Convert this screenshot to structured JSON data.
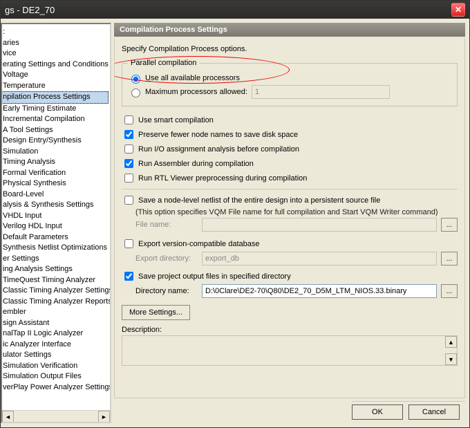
{
  "window": {
    "title_suffix": "gs - DE2_70"
  },
  "sidebar": {
    "items": [
      {
        "label": ":"
      },
      {
        "label": "aries"
      },
      {
        "label": "vice"
      },
      {
        "label": "erating Settings and Conditions"
      },
      {
        "label": "Voltage"
      },
      {
        "label": "Temperature"
      },
      {
        "label": "npilation Process Settings",
        "selected": true
      },
      {
        "label": "Early Timing Estimate"
      },
      {
        "label": "Incremental Compilation"
      },
      {
        "label": "A Tool Settings"
      },
      {
        "label": "Design Entry/Synthesis"
      },
      {
        "label": "Simulation"
      },
      {
        "label": "Timing Analysis"
      },
      {
        "label": "Formal Verification"
      },
      {
        "label": "Physical Synthesis"
      },
      {
        "label": "Board-Level"
      },
      {
        "label": "alysis & Synthesis Settings"
      },
      {
        "label": "VHDL Input"
      },
      {
        "label": "Verilog HDL Input"
      },
      {
        "label": "Default Parameters"
      },
      {
        "label": "Synthesis Netlist Optimizations"
      },
      {
        "label": "er Settings"
      },
      {
        "label": "ing Analysis Settings"
      },
      {
        "label": "TimeQuest Timing Analyzer"
      },
      {
        "label": "Classic Timing Analyzer Settings"
      },
      {
        "label": "  Classic Timing Analyzer Reports"
      },
      {
        "label": "embler"
      },
      {
        "label": "sign Assistant"
      },
      {
        "label": "nalTap II Logic Analyzer"
      },
      {
        "label": "ic Analyzer Interface"
      },
      {
        "label": "ulator Settings"
      },
      {
        "label": "Simulation Verification"
      },
      {
        "label": "Simulation Output Files"
      },
      {
        "label": "verPlay Power Analyzer Settings"
      }
    ]
  },
  "panel": {
    "title": "Compilation Process Settings",
    "intro": "Specify Compilation Process options.",
    "parallel": {
      "legend": "Parallel compilation",
      "use_all": "Use all available processors",
      "max_label": "Maximum processors allowed:",
      "max_value": "1"
    },
    "checks": {
      "smart": "Use smart compilation",
      "preserve": "Preserve fewer node names to save disk space",
      "runio": "Run I/O assignment analysis before compilation",
      "runasm": "Run Assembler during compilation",
      "runrtl": "Run RTL Viewer preprocessing during compilation",
      "savenetlist": "Save a node-level netlist of the entire design into a persistent source file",
      "savenetlist_note": "(This option specifies VQM File name for full compilation and Start VQM Writer command)",
      "filename_label": "File name:",
      "exportdb": "Export version-compatible database",
      "exportdir_label": "Export directory:",
      "exportdir_value": "export_db",
      "saveout": "Save project output files in specified directory",
      "dirname_label": "Directory name:",
      "dirname_value": "D:\\0Clare\\DE2-70\\Q80\\DE2_70_D5M_LTM_NIOS.33.binary"
    },
    "more": "More Settings...",
    "desc_label": "Description:"
  },
  "buttons": {
    "ok": "OK",
    "cancel": "Cancel"
  }
}
